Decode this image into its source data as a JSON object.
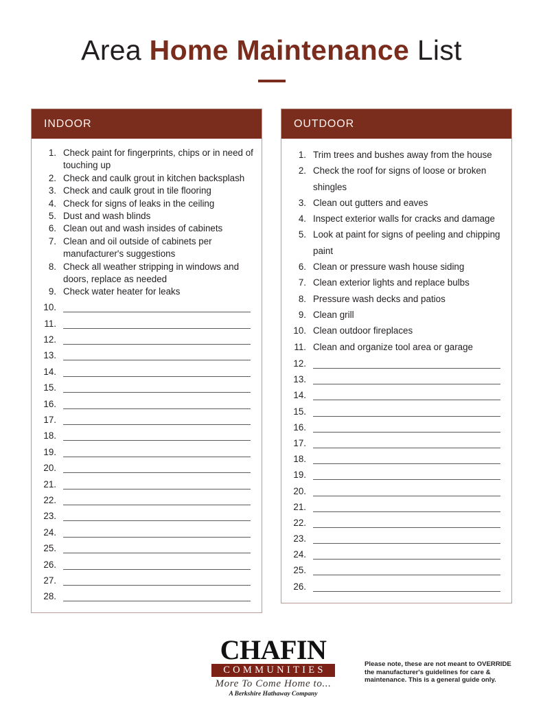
{
  "document": {
    "title_prefix": "Area ",
    "title_accent": "Home Maintenance",
    "title_suffix": " List",
    "accent_color": "#7b2d1d",
    "border_color": "#b99b94",
    "rule_color": "#5a5a5a"
  },
  "indoor": {
    "header": "INDOOR",
    "items": [
      {
        "num": "1.",
        "text": "Check paint for fingerprints, chips or in need of touching up"
      },
      {
        "num": "2.",
        "text": "Check and caulk grout in kitchen backsplash"
      },
      {
        "num": "3.",
        "text": "Check and caulk grout in tile flooring"
      },
      {
        "num": "4.",
        "text": "Check for signs of leaks in the ceiling"
      },
      {
        "num": "5.",
        "text": "Dust and wash blinds"
      },
      {
        "num": "6.",
        "text": "Clean out and wash insides of cabinets"
      },
      {
        "num": "7.",
        "text": "Clean and oil outside of cabinets per manufacturer's suggestions"
      },
      {
        "num": "8.",
        "text": "Check all weather stripping in windows and doors, replace as needed"
      },
      {
        "num": "9.",
        "text": "Check water heater for leaks"
      }
    ],
    "blanks": [
      "10.",
      "11.",
      "12.",
      "13.",
      "14.",
      "15.",
      "16.",
      "17.",
      "18.",
      "19.",
      "20.",
      "21.",
      "22.",
      "23.",
      "24.",
      "25.",
      "26.",
      "27.",
      "28."
    ]
  },
  "outdoor": {
    "header": "OUTDOOR",
    "items": [
      {
        "num": "1.",
        "text": "Trim trees and bushes away from the house"
      },
      {
        "num": "2.",
        "text": "Check the roof for signs of loose or broken shingles"
      },
      {
        "num": "3.",
        "text": "Clean out gutters and eaves"
      },
      {
        "num": "4.",
        "text": "Inspect exterior walls for cracks and damage"
      },
      {
        "num": "5.",
        "text": "Look at paint for signs of peeling and chipping paint"
      },
      {
        "num": "6.",
        "text": "Clean or pressure wash house siding"
      },
      {
        "num": "7.",
        "text": "Clean exterior lights and replace bulbs"
      },
      {
        "num": "8.",
        "text": "Pressure wash decks and patios"
      },
      {
        "num": "9.",
        "text": "Clean grill"
      },
      {
        "num": "10.",
        "text": "Clean outdoor fireplaces"
      },
      {
        "num": "11.",
        "text": "Clean and organize tool area or garage"
      }
    ],
    "blanks": [
      "12.",
      "13.",
      "14.",
      "15.",
      "16.",
      "17.",
      "18.",
      "19.",
      "20.",
      "21.",
      "22.",
      "23.",
      "24.",
      "25.",
      "26."
    ]
  },
  "footer": {
    "logo_main": "CHAFIN",
    "logo_sub": "COMMUNITIES",
    "logo_tagline": "More To Come Home to...",
    "logo_affiliation": "A Berkshire Hathaway Company",
    "disclaimer": "Please note, these are not meant to OVERRIDE the manufacturer's guidelines for care & maintenance.  This is a general guide only."
  }
}
